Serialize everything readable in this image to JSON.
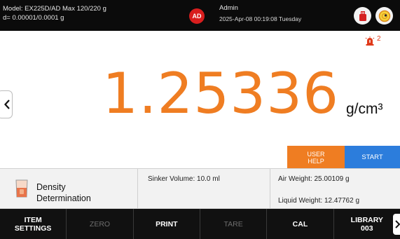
{
  "header": {
    "model_line": "Model: EX225D/AD   Max 120/220 g",
    "readability_line": "d= 0.00001/0.0001 g",
    "user_initials": "AD",
    "user_name": "Admin",
    "datetime": "2025-Apr-08 00:19:08 Tuesday",
    "icons": {
      "usb": "usb-drive-icon",
      "level": "level-indicator-icon"
    }
  },
  "display": {
    "reading": "1.25336",
    "unit": "g/cm³",
    "reading_color": "#ef7d22",
    "alarm_icon": "alarm-light-icon",
    "alarm_count": "2",
    "help_button": "USER HELP",
    "start_button": "START",
    "help_color": "#ef7d22",
    "start_color": "#2c7ddc"
  },
  "info": {
    "app_icon": "density-beaker-icon",
    "app_title": "Density Determination",
    "sinker_volume": "Sinker Volume: 10.0 ml",
    "air_weight": "Air Weight: 25.00109 g",
    "liquid_weight": "Liquid Weight: 12.47762 g"
  },
  "toolbar": {
    "item_settings": "ITEM SETTINGS",
    "zero": "ZERO",
    "print": "PRINT",
    "tare": "TARE",
    "cal": "CAL",
    "library": "LIBRARY 003"
  }
}
